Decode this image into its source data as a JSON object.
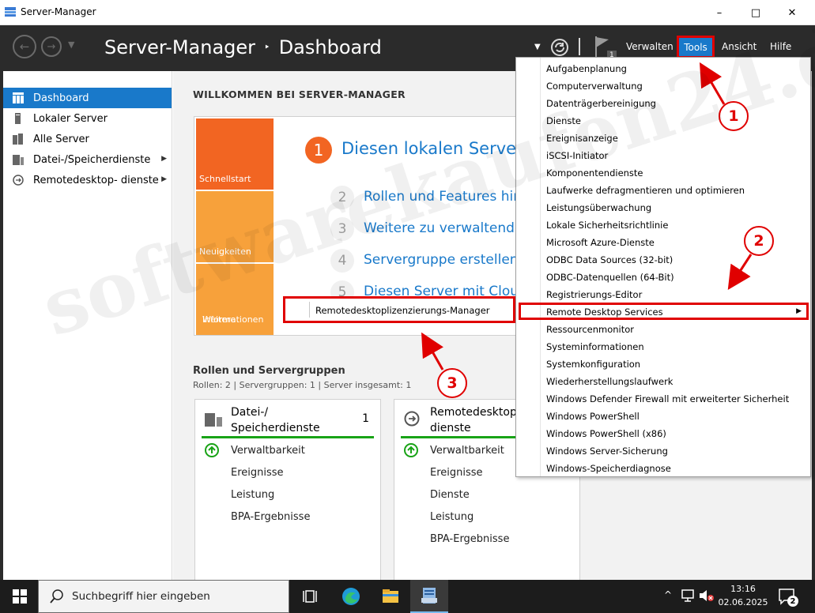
{
  "window": {
    "title": "Server-Manager",
    "minimize": "–",
    "maximize": "□",
    "close": "✕"
  },
  "header": {
    "breadcrumb_root": "Server-Manager",
    "breadcrumb_sep": "‣",
    "breadcrumb_page": "Dashboard",
    "flag_count": "1",
    "menu": {
      "verwalten": "Verwalten",
      "tools": "Tools",
      "ansicht": "Ansicht",
      "hilfe": "Hilfe"
    }
  },
  "sidebar": {
    "items": [
      {
        "label": "Dashboard",
        "icon": "dashboard-icon"
      },
      {
        "label": "Lokaler Server",
        "icon": "server-icon"
      },
      {
        "label": "Alle Server",
        "icon": "servers-icon"
      },
      {
        "label": "Datei-/Speicherdienste",
        "icon": "storage-icon"
      },
      {
        "label": "Remotedesktop- dienste",
        "icon": "remote-desktop-icon"
      }
    ]
  },
  "main": {
    "welcome": "WILLKOMMEN BEI SERVER-MANAGER",
    "tiles": {
      "quickstart": "Schnellstart",
      "news": "Neuigkeiten",
      "more_1": "Weitere",
      "more_2": "Informationen"
    },
    "steps": [
      {
        "num": "1",
        "text": "Diesen lokalen Server konfigurieren"
      },
      {
        "num": "2",
        "text": "Rollen und Features hinzufügen"
      },
      {
        "num": "3",
        "text": "Weitere zu verwaltende Server hinzufügen"
      },
      {
        "num": "4",
        "text": "Servergruppe erstellen"
      },
      {
        "num": "5",
        "text": "Diesen Server mit Cloud-Diensten verbinden"
      }
    ],
    "roles_title": "Rollen und Servergruppen",
    "roles_sub": "Rollen: 2   |   Servergruppen: 1   |   Server insgesamt: 1",
    "cards": [
      {
        "title_1": "Datei-/",
        "title_2": "Speicherdienste",
        "count": "1",
        "items": [
          "Verwaltbarkeit",
          "Ereignisse",
          "Leistung",
          "BPA-Ergebnisse"
        ]
      },
      {
        "title_1": "Remotedesktop",
        "title_2": "dienste",
        "count": "",
        "items": [
          "Verwaltbarkeit",
          "Ereignisse",
          "Dienste",
          "Leistung",
          "BPA-Ergebnisse"
        ]
      }
    ]
  },
  "tools_menu": {
    "items": [
      "Aufgabenplanung",
      "Computerverwaltung",
      "Datenträgerbereinigung",
      "Dienste",
      "Ereignisanzeige",
      "iSCSI-Initiator",
      "Komponentendienste",
      "Laufwerke defragmentieren und optimieren",
      "Leistungsüberwachung",
      "Lokale Sicherheitsrichtlinie",
      "Microsoft Azure-Dienste",
      "ODBC Data Sources (32-bit)",
      "ODBC-Datenquellen (64-Bit)",
      "Registrierungs-Editor",
      "Remote Desktop Services",
      "Ressourcenmonitor",
      "Systeminformationen",
      "Systemkonfiguration",
      "Wiederherstellungslaufwerk",
      "Windows Defender Firewall mit erweiterter Sicherheit",
      "Windows PowerShell",
      "Windows PowerShell (x86)",
      "Windows Server-Sicherung",
      "Windows-Speicherdiagnose"
    ],
    "submenu_arrow": "▶"
  },
  "submenu": {
    "item": "Remotedesktoplizenzierungs-Manager"
  },
  "callouts": [
    "1",
    "2",
    "3"
  ],
  "watermark": "softwarekaufen24.de",
  "taskbar": {
    "search_placeholder": "Suchbegriff hier eingeben",
    "time": "13:16",
    "date": "02.06.2025",
    "notif_count": "2"
  },
  "colors": {
    "accent": "#1979ca",
    "header_bg": "#2b2b2b",
    "quickstart": "#f26522",
    "tile_light": "#f7a13b",
    "annotation_red": "#e00000",
    "ok_green": "#18a316"
  }
}
